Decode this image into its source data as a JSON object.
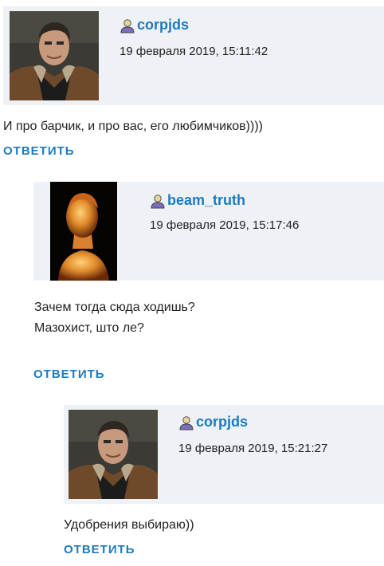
{
  "comments": [
    {
      "username": "corpjds",
      "timestamp": "19 февраля 2019, 15:11:42",
      "lines": [
        "И про барчик, и про вас, его любимчиков))))"
      ],
      "reply_label": "Ответить"
    },
    {
      "username": "beam_truth",
      "timestamp": "19 февраля 2019, 15:17:46",
      "lines": [
        "Зачем тогда сюда ходишь?",
        "Мазохист, што ле?"
      ],
      "reply_label": "Ответить"
    },
    {
      "username": "corpjds",
      "timestamp": "19 февраля 2019, 15:21:27",
      "lines": [
        "Удобрения выбираю))"
      ],
      "reply_label": "Ответить"
    }
  ],
  "colors": {
    "link": "#1b7bbf",
    "header_bg": "#eef1f5"
  },
  "icons": {
    "user": "user-icon"
  }
}
